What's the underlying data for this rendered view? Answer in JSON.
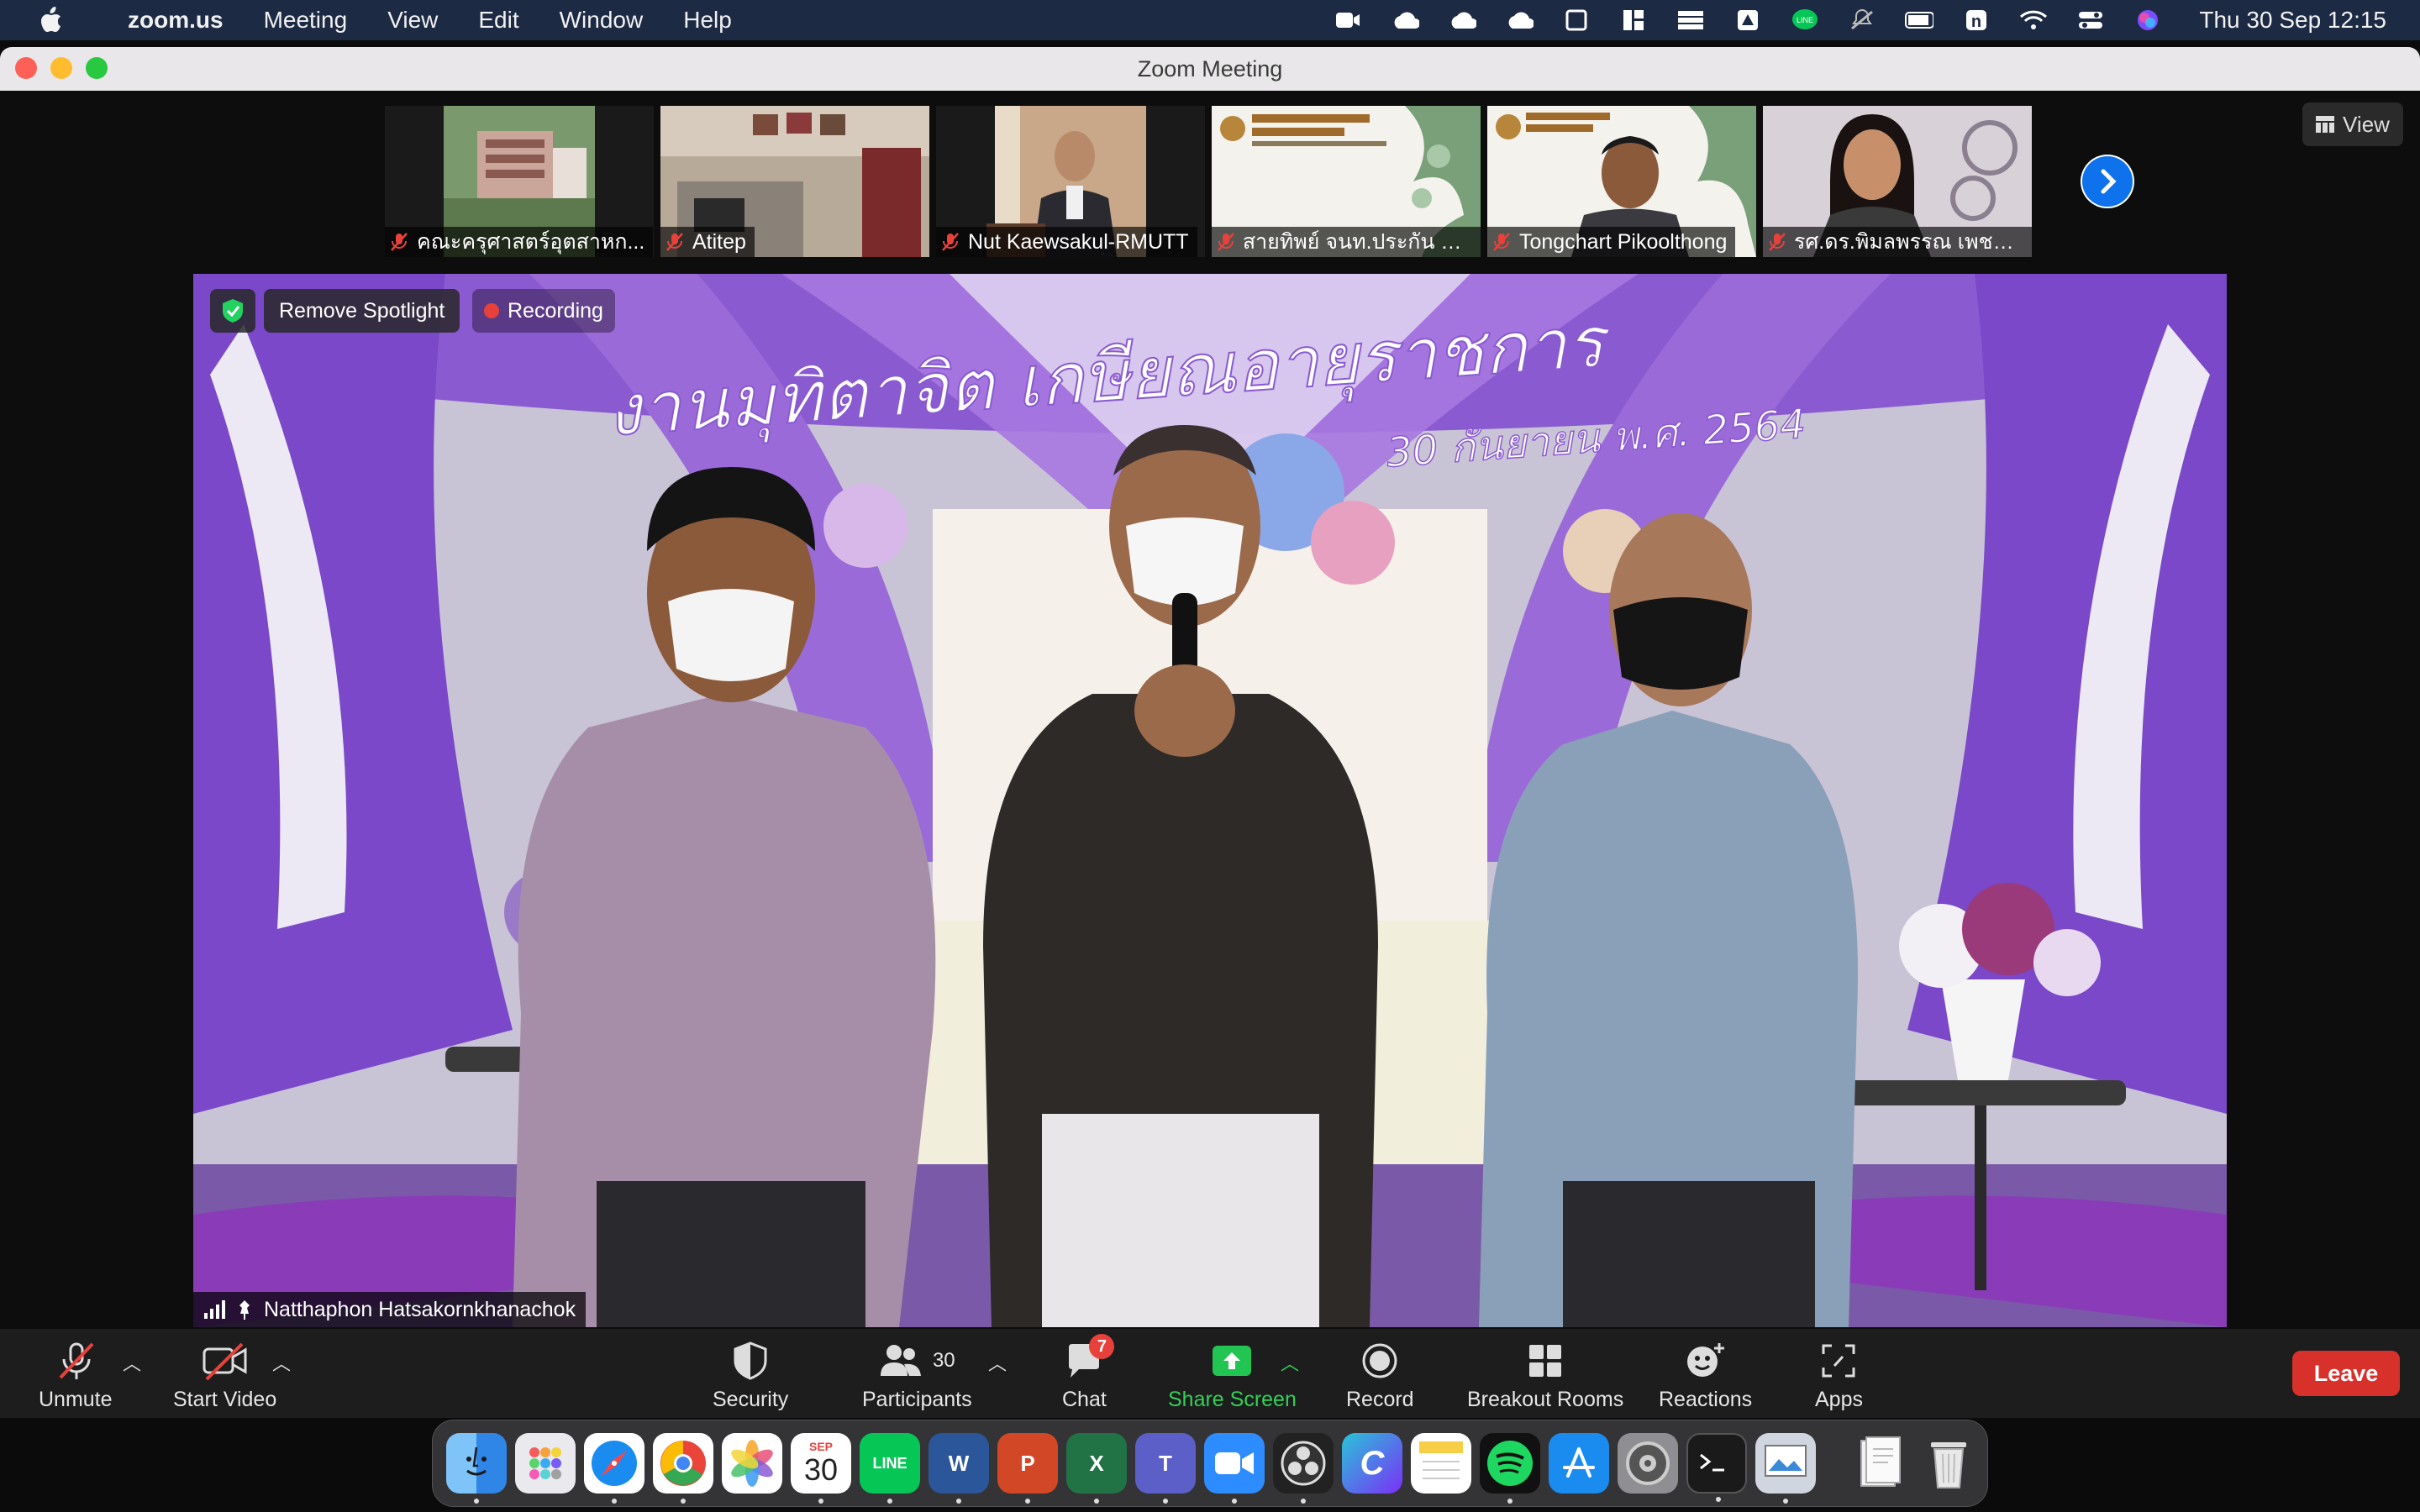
{
  "menubar": {
    "app_name": "zoom.us",
    "items": [
      "Meeting",
      "View",
      "Edit",
      "Window",
      "Help"
    ],
    "clock": "Thu 30 Sep  12:15",
    "status_icons": [
      "zoom-status-icon",
      "cloud-icon",
      "cloud-icon",
      "cloud-icon",
      "window-icon",
      "layout-icon",
      "stack-icon",
      "arrow-box-icon",
      "line-icon",
      "mute-bell-icon",
      "battery-icon",
      "letter-n-icon",
      "wifi-icon",
      "control-center-icon",
      "siri-icon"
    ]
  },
  "window": {
    "title": "Zoom Meeting"
  },
  "view_button": {
    "label": "View"
  },
  "thumbnails": [
    {
      "name": "คณะครุศาสตร์อุตสาหก...",
      "muted": true,
      "kind": "building"
    },
    {
      "name": "Atitep",
      "muted": true,
      "kind": "room"
    },
    {
      "name": "Nut Kaewsakul-RMUTT",
      "muted": true,
      "kind": "person"
    },
    {
      "name": "สายทิพย์ จนท.ประกัน คอ...",
      "muted": true,
      "kind": "banner"
    },
    {
      "name": "Tongchart Pikoolthong",
      "muted": true,
      "kind": "banner-person"
    },
    {
      "name": "รศ.ดร.พิมลพรรณ เพชรส...",
      "muted": true,
      "kind": "woman"
    }
  ],
  "spotlight": {
    "remove_label": "Remove Spotlight",
    "recording_label": "Recording",
    "speaker_name": "Natthaphon Hatsakornkhanachok",
    "banner_text": "งานมุทิตาจิต เกษียณอายุราชการ",
    "banner_date": "30 กันยายน พ.ศ. 2564"
  },
  "toolbar": {
    "unmute": "Unmute",
    "start_video": "Start Video",
    "security": "Security",
    "participants": "Participants",
    "participants_count": "30",
    "chat": "Chat",
    "chat_badge": "7",
    "share_screen": "Share Screen",
    "record": "Record",
    "breakout_rooms": "Breakout Rooms",
    "reactions": "Reactions",
    "apps": "Apps",
    "leave": "Leave"
  },
  "dock": {
    "calendar_month": "SEP",
    "calendar_day": "30",
    "line_label": "LINE",
    "word_label": "W",
    "powerpoint_label": "P",
    "excel_label": "X",
    "teams_label": "T",
    "canva_label": "C"
  },
  "colors": {
    "menubar_bg": "#1c2a44",
    "toolbar_bg": "#1d1d1d",
    "leave_red": "#d8312c",
    "share_green": "#34d058",
    "muted_red": "#e8413b"
  }
}
